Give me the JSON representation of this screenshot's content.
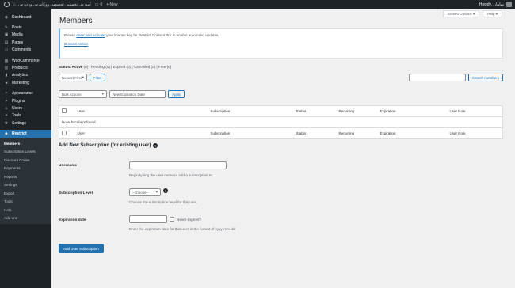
{
  "adminbar": {
    "site_name": "آموزش نخستین تخصصی ووکامرس وردپرس",
    "comments_count": "0",
    "new_label": "+ New",
    "user_label": "Howdy, سامان"
  },
  "sidebar": {
    "items": [
      {
        "label": "Dashboard",
        "icon": "dashboard-icon",
        "glyph": "◉"
      },
      {
        "label": "Posts",
        "icon": "posts-icon",
        "glyph": "✎"
      },
      {
        "label": "Media",
        "icon": "media-icon",
        "glyph": "▣"
      },
      {
        "label": "Pages",
        "icon": "pages-icon",
        "glyph": "▤"
      },
      {
        "label": "Comments",
        "icon": "comments-icon",
        "glyph": "▭"
      },
      {
        "label": "WooCommerce",
        "icon": "woocommerce-icon",
        "glyph": "▦"
      },
      {
        "label": "Products",
        "icon": "products-icon",
        "glyph": "▥"
      },
      {
        "label": "Analytics",
        "icon": "analytics-icon",
        "glyph": "▮"
      },
      {
        "label": "Marketing",
        "icon": "marketing-icon",
        "glyph": "◂"
      },
      {
        "label": "Appearance",
        "icon": "appearance-icon",
        "glyph": "✧"
      },
      {
        "label": "Plugins",
        "icon": "plugins-icon",
        "glyph": "⚡"
      },
      {
        "label": "Users",
        "icon": "users-icon",
        "glyph": "☺"
      },
      {
        "label": "Tools",
        "icon": "tools-icon",
        "glyph": "✦"
      },
      {
        "label": "Settings",
        "icon": "settings-icon",
        "glyph": "⚙"
      },
      {
        "label": "Restrict",
        "icon": "lock-icon",
        "glyph": "◈"
      }
    ],
    "submenu": [
      "Members",
      "Subscription Levels",
      "Discount Codes",
      "Payments",
      "Reports",
      "Settings",
      "Export",
      "Tools",
      "Help",
      "Add-ons"
    ]
  },
  "screen_options": "Screen Options ▾",
  "help": "Help ▾",
  "page_title": "Members",
  "notice": {
    "text_before": "Please ",
    "link": "enter and activate",
    "text_after": " your license key for Restrict Content Pro to enable automatic updates.",
    "dismiss": "Dismiss Notice"
  },
  "status": {
    "all": "Status: Active",
    "active_count": "(0)",
    "rest": "| Pending (0) | Expired (0) | Cancelled (0) | Free (0)"
  },
  "filter": {
    "sort_select": "Newest First",
    "filter_button": "Filter",
    "search_button": "Search members"
  },
  "bulk": {
    "select": "Bulk Actions",
    "date_placeholder": "New Expiration Date",
    "apply_button": "Apply"
  },
  "table": {
    "columns": [
      "User",
      "Subscription",
      "Status",
      "Recurring",
      "Expiration",
      "User Role"
    ],
    "empty": "No subscribers found"
  },
  "add_new": {
    "title": "Add New Subscription (for existing user)",
    "username_label": "Username",
    "username_desc": "Begin typing the user name to add a subscription to.",
    "level_label": "Subscription Level",
    "level_select": "--choose--",
    "level_desc": "Choose the subscription level for this user.",
    "expiration_label": "Expiration date",
    "never_expires": "Never expires?",
    "expiration_desc": "Enter the expiration date for this user in the format of yyyy-mm-dd",
    "submit": "Add User Subscription"
  },
  "colors": {
    "accent": "#2271b1",
    "sidebar": "#1d2327",
    "notice_border": "#72aee6"
  }
}
